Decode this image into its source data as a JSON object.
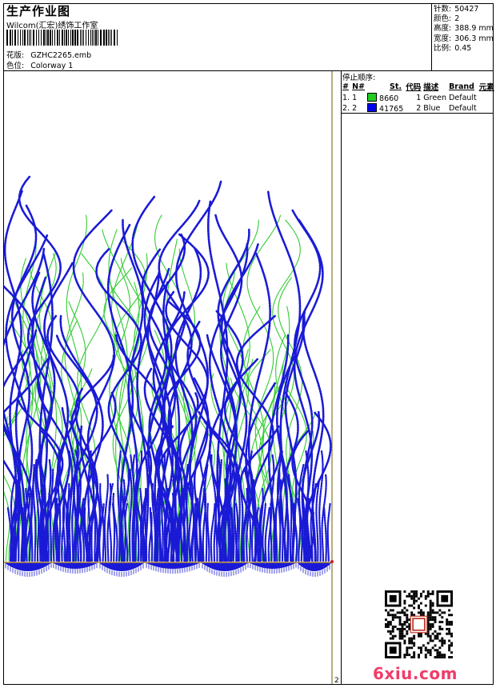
{
  "header": {
    "title": "生产作业图",
    "company": "Wilcom(汇宏)绣饰工作室",
    "pattern_label": "花版:",
    "pattern_value": "GZHC2265.emb",
    "colorway_label": "色位:",
    "colorway_value": "Colorway 1"
  },
  "specs": [
    {
      "label": "针数:",
      "value": "50427"
    },
    {
      "label": "颜色:",
      "value": "2"
    },
    {
      "label": "高度:",
      "value": "388.9 mm"
    },
    {
      "label": "宽度:",
      "value": "306.3 mm"
    },
    {
      "label": "比例:",
      "value": "0.45"
    }
  ],
  "stop_sequence": {
    "title": "停止顺序:",
    "columns": [
      "#",
      "N#",
      "St.",
      "代码",
      "描述",
      "Brand",
      "元素"
    ],
    "rows": [
      {
        "index": "1.",
        "n": "1",
        "color": "#22cc22",
        "stitches": "8660",
        "code": "1",
        "desc": "Green",
        "brand": "Default",
        "element": ""
      },
      {
        "index": "2.",
        "n": "2",
        "color": "#0000ee",
        "stitches": "41765",
        "code": "2",
        "desc": "Blue",
        "brand": "Default",
        "element": ""
      }
    ]
  },
  "design": {
    "thread_blue": "#1a1ad6",
    "thread_green": "#33cc33",
    "baseline": "#c8a040"
  },
  "ruler_number": "2",
  "watermark": "6xiu.com"
}
